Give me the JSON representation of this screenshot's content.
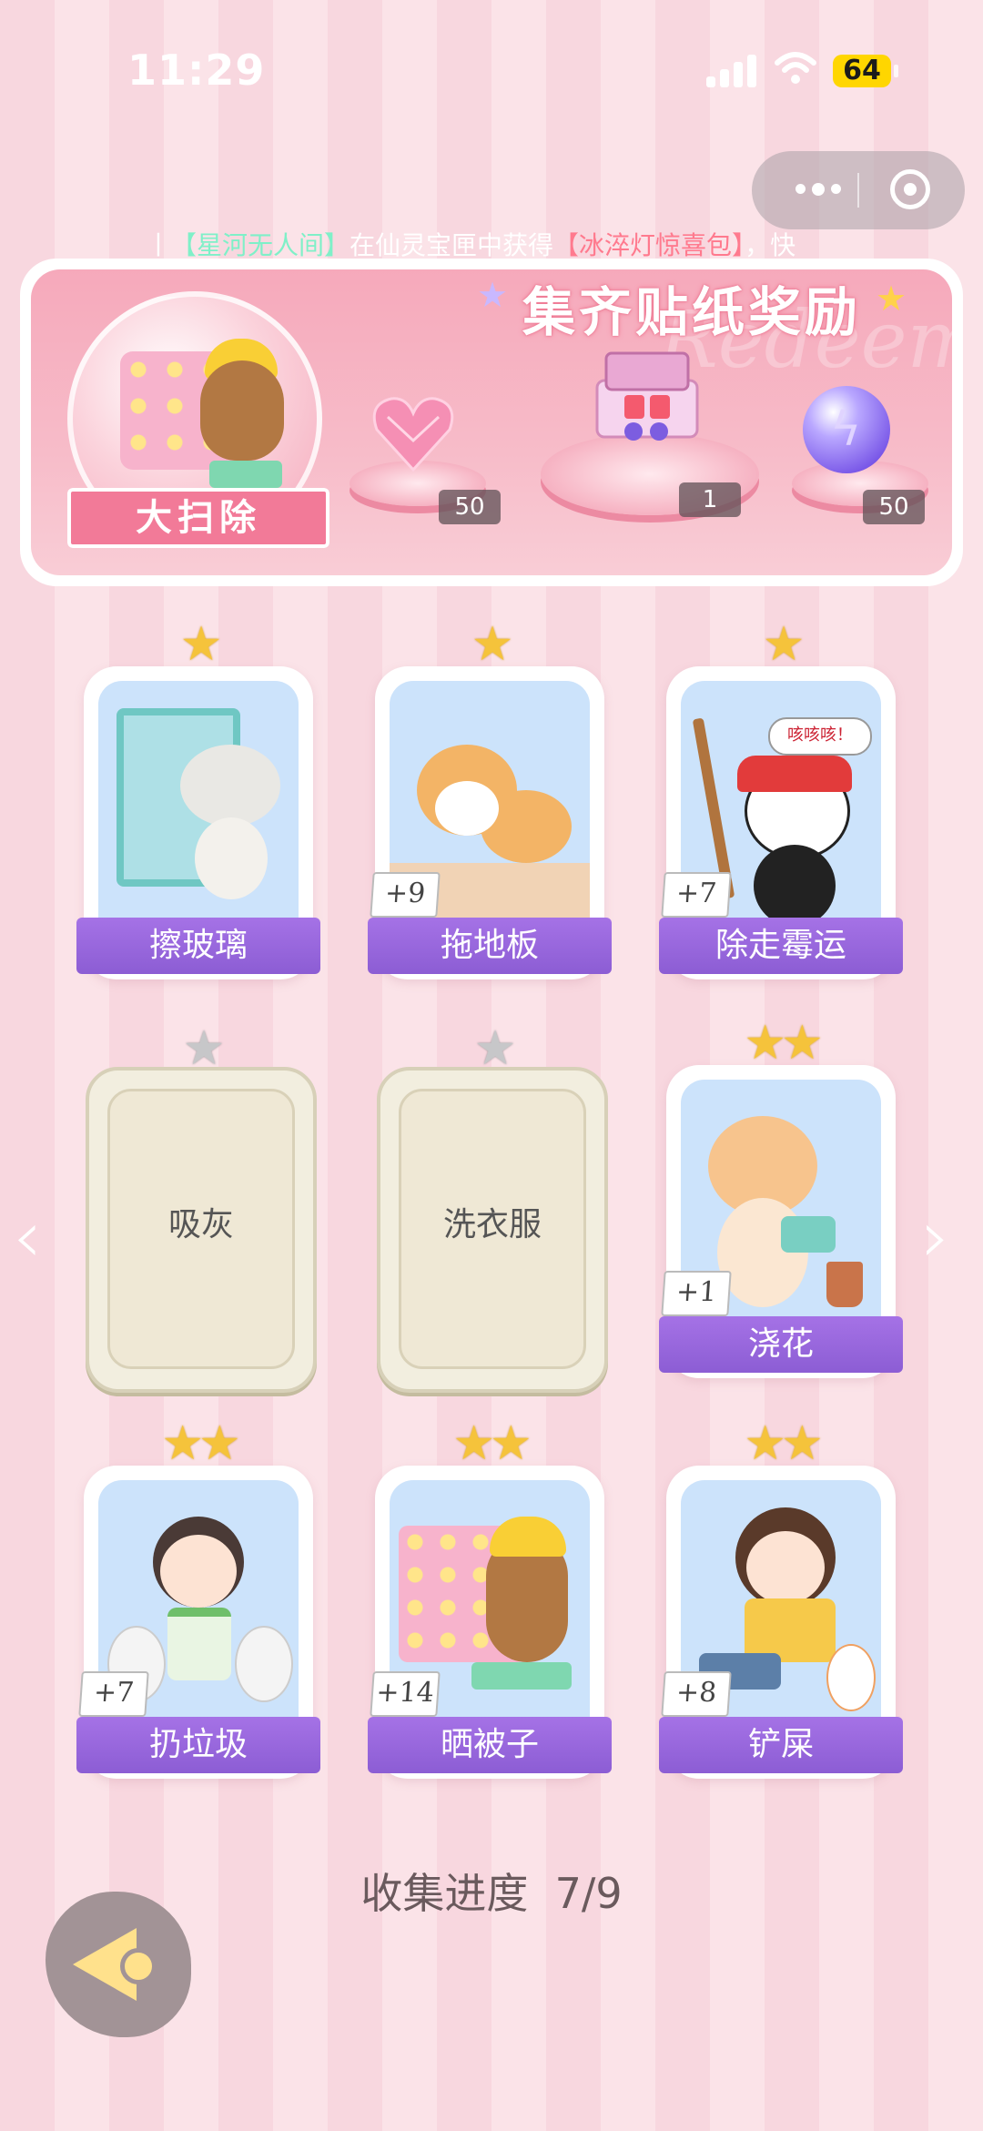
{
  "status": {
    "time": "11:29",
    "battery": "64"
  },
  "ticker": {
    "prefix": "丨",
    "user": "【星河无人间】",
    "middle": "在仙灵宝匣中获得",
    "item": "【冰淬灯惊喜包】",
    "suffix": "，快"
  },
  "banner": {
    "title": "集齐贴纸奖励",
    "watermark": "Redeem",
    "theme_label": "大扫除",
    "rewards": [
      {
        "icon": "heart-gem-icon",
        "count": "50"
      },
      {
        "icon": "gift-box-icon",
        "count": "1"
      },
      {
        "icon": "lightning-orb-icon",
        "count": "50"
      }
    ]
  },
  "cards": [
    {
      "label": "擦玻璃",
      "stars": "★",
      "plus": "",
      "locked": false
    },
    {
      "label": "拖地板",
      "stars": "★",
      "plus": "+9",
      "locked": false
    },
    {
      "label": "除走霉运",
      "stars": "★",
      "plus": "+7",
      "locked": false
    },
    {
      "label": "吸灰",
      "stars": "★",
      "plus": "",
      "locked": true
    },
    {
      "label": "洗衣服",
      "stars": "★",
      "plus": "",
      "locked": true
    },
    {
      "label": "浇花",
      "stars": "★★",
      "plus": "+1",
      "locked": false
    },
    {
      "label": "扔垃圾",
      "stars": "★★",
      "plus": "+7",
      "locked": false
    },
    {
      "label": "晒被子",
      "stars": "★★",
      "plus": "+14",
      "locked": false
    },
    {
      "label": "铲屎",
      "stars": "★★",
      "plus": "+8",
      "locked": false
    }
  ],
  "panda_speech": "咳咳咳！",
  "nav": {
    "prev": "‹",
    "next": "›"
  },
  "progress": {
    "label": "收集进度",
    "value": "7/9"
  },
  "colors": {
    "accent_purple": "#9a66dc",
    "pink": "#f27a98",
    "gold": "#f5c33b"
  }
}
